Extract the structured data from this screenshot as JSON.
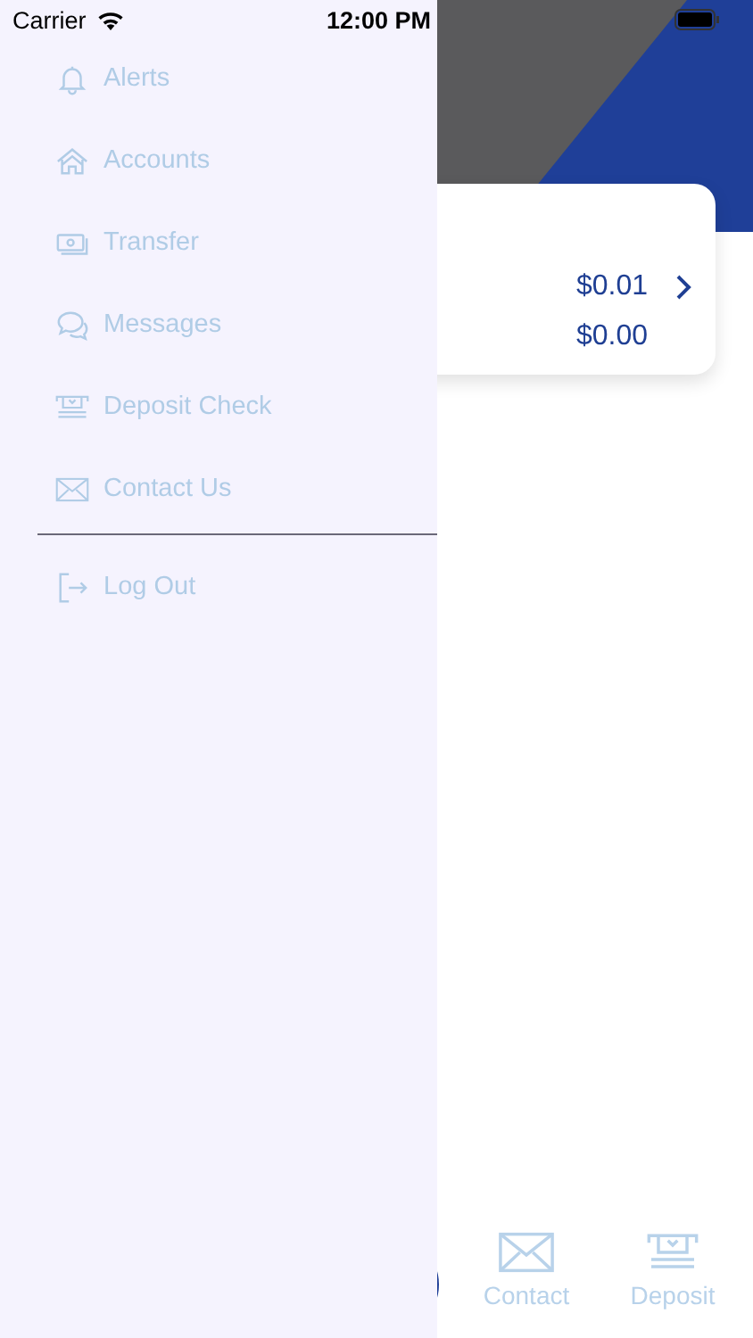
{
  "status_bar": {
    "carrier": "Carrier",
    "time": "12:00 PM"
  },
  "card": {
    "amounts": [
      "$0.01",
      "$0.00"
    ]
  },
  "tab_bar": [
    {
      "label": "Contact",
      "kind": "mail"
    },
    {
      "label": "Deposit",
      "kind": "deposit"
    }
  ],
  "drawer": {
    "items": [
      {
        "label": "Alerts",
        "kind": "bell"
      },
      {
        "label": "Accounts",
        "kind": "house"
      },
      {
        "label": "Transfer",
        "kind": "cash"
      },
      {
        "label": "Messages",
        "kind": "chat"
      },
      {
        "label": "Deposit Check",
        "kind": "deposit"
      },
      {
        "label": "Contact Us",
        "kind": "mail"
      }
    ],
    "footer_items": [
      {
        "label": "Log Out",
        "kind": "logout"
      }
    ]
  }
}
